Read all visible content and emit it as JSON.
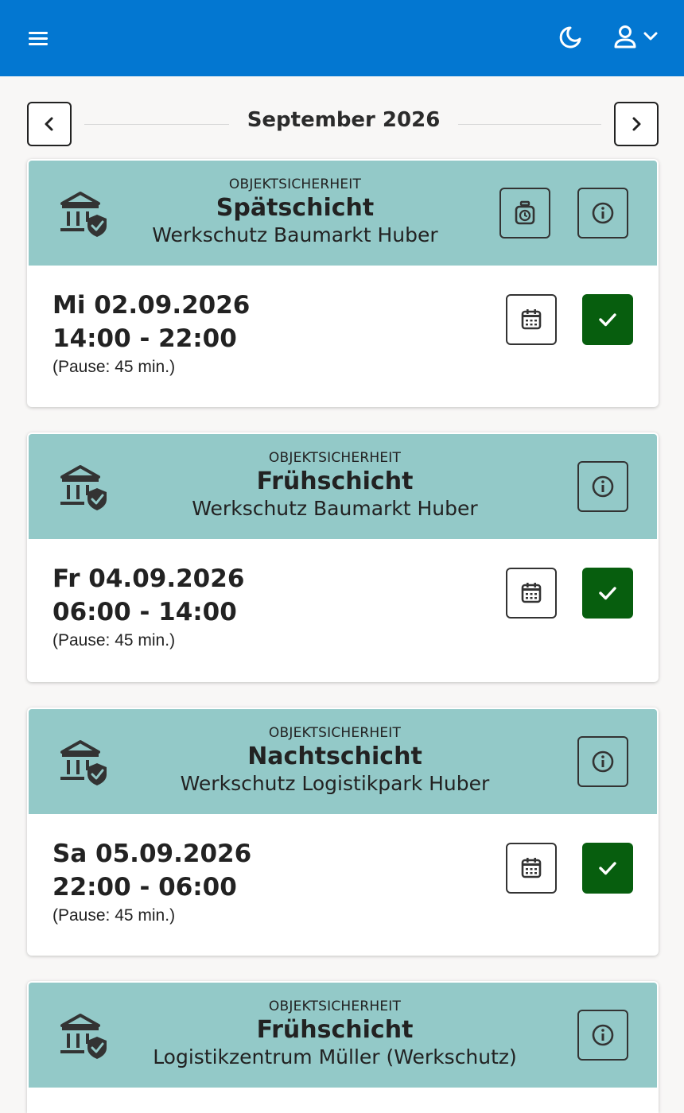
{
  "header": {
    "menu_icon": "hamburger-icon",
    "theme_icon": "moon-icon",
    "user_icon": "user-icon",
    "user_dropdown_icon": "chevron-down-icon",
    "background_color": "#0377d1"
  },
  "month_nav": {
    "title": "September 2026",
    "prev_icon": "chevron-left-icon",
    "next_icon": "chevron-right-icon"
  },
  "colors": {
    "card_header": "#93c9c8",
    "confirm_button": "#075e0e"
  },
  "shifts": [
    {
      "category": "OBJEKTSICHERHEIT",
      "shift_name": "Spätschicht",
      "location": "Werkschutz Baumarkt Huber",
      "has_timer": true,
      "date": "Mi 02.09.2026",
      "time": "14:00 - 22:00",
      "pause": "(Pause: 45 min.)"
    },
    {
      "category": "OBJEKTSICHERHEIT",
      "shift_name": "Frühschicht",
      "location": "Werkschutz Baumarkt Huber",
      "has_timer": false,
      "date": "Fr 04.09.2026",
      "time": "06:00 - 14:00",
      "pause": "(Pause: 45 min.)"
    },
    {
      "category": "OBJEKTSICHERHEIT",
      "shift_name": "Nachtschicht",
      "location": "Werkschutz Logistikpark Huber",
      "has_timer": false,
      "date": "Sa 05.09.2026",
      "time": "22:00 - 06:00",
      "pause": "(Pause: 45 min.)"
    },
    {
      "category": "OBJEKTSICHERHEIT",
      "shift_name": "Frühschicht",
      "location": "Logistikzentrum Müller (Werkschutz)",
      "has_timer": false
    }
  ]
}
